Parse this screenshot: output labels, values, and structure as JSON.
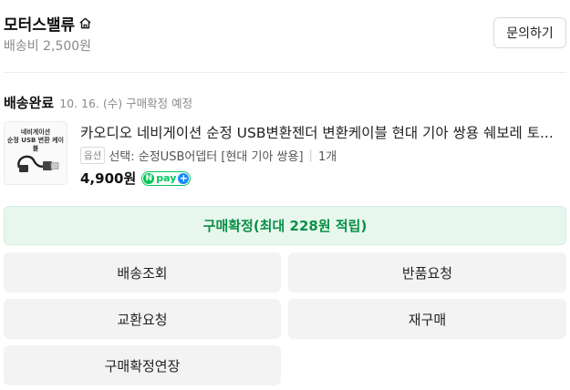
{
  "store": {
    "name": "모터스밸류",
    "home_icon": "home-icon",
    "shipping_fee": "배송비 2,500원",
    "inquiry_label": "문의하기"
  },
  "order": {
    "status": "배송완료",
    "status_detail": "10. 16. (수) 구매확정 예정"
  },
  "product": {
    "thumbnail_text_line1": "네비게이션",
    "thumbnail_text_line2": "순정 USB 변환 케이블",
    "title": "카오디오 네비게이션 순정 USB변환젠더 변환케이블 현대 기아 쌍용 쉐보레 토...",
    "option_badge": "옵션",
    "option_text": "선택: 순정USB어뎁터 [현대 기아 쌍용]",
    "separator": "|",
    "quantity": "1개",
    "price": "4,900원",
    "npay_n": "N",
    "npay_text": "pay",
    "npay_plus": "+"
  },
  "actions": {
    "confirm_label": "구매확정(최대 228원 적립)",
    "track_label": "배송조회",
    "return_label": "반품요청",
    "exchange_label": "교환요청",
    "rebuy_label": "재구매",
    "extend_label": "구매확정연장"
  },
  "colors": {
    "accent_green": "#03c75a",
    "confirm_bg": "#e8f7ee",
    "confirm_text": "#0a8f47",
    "button_bg": "#f3f3f3"
  }
}
